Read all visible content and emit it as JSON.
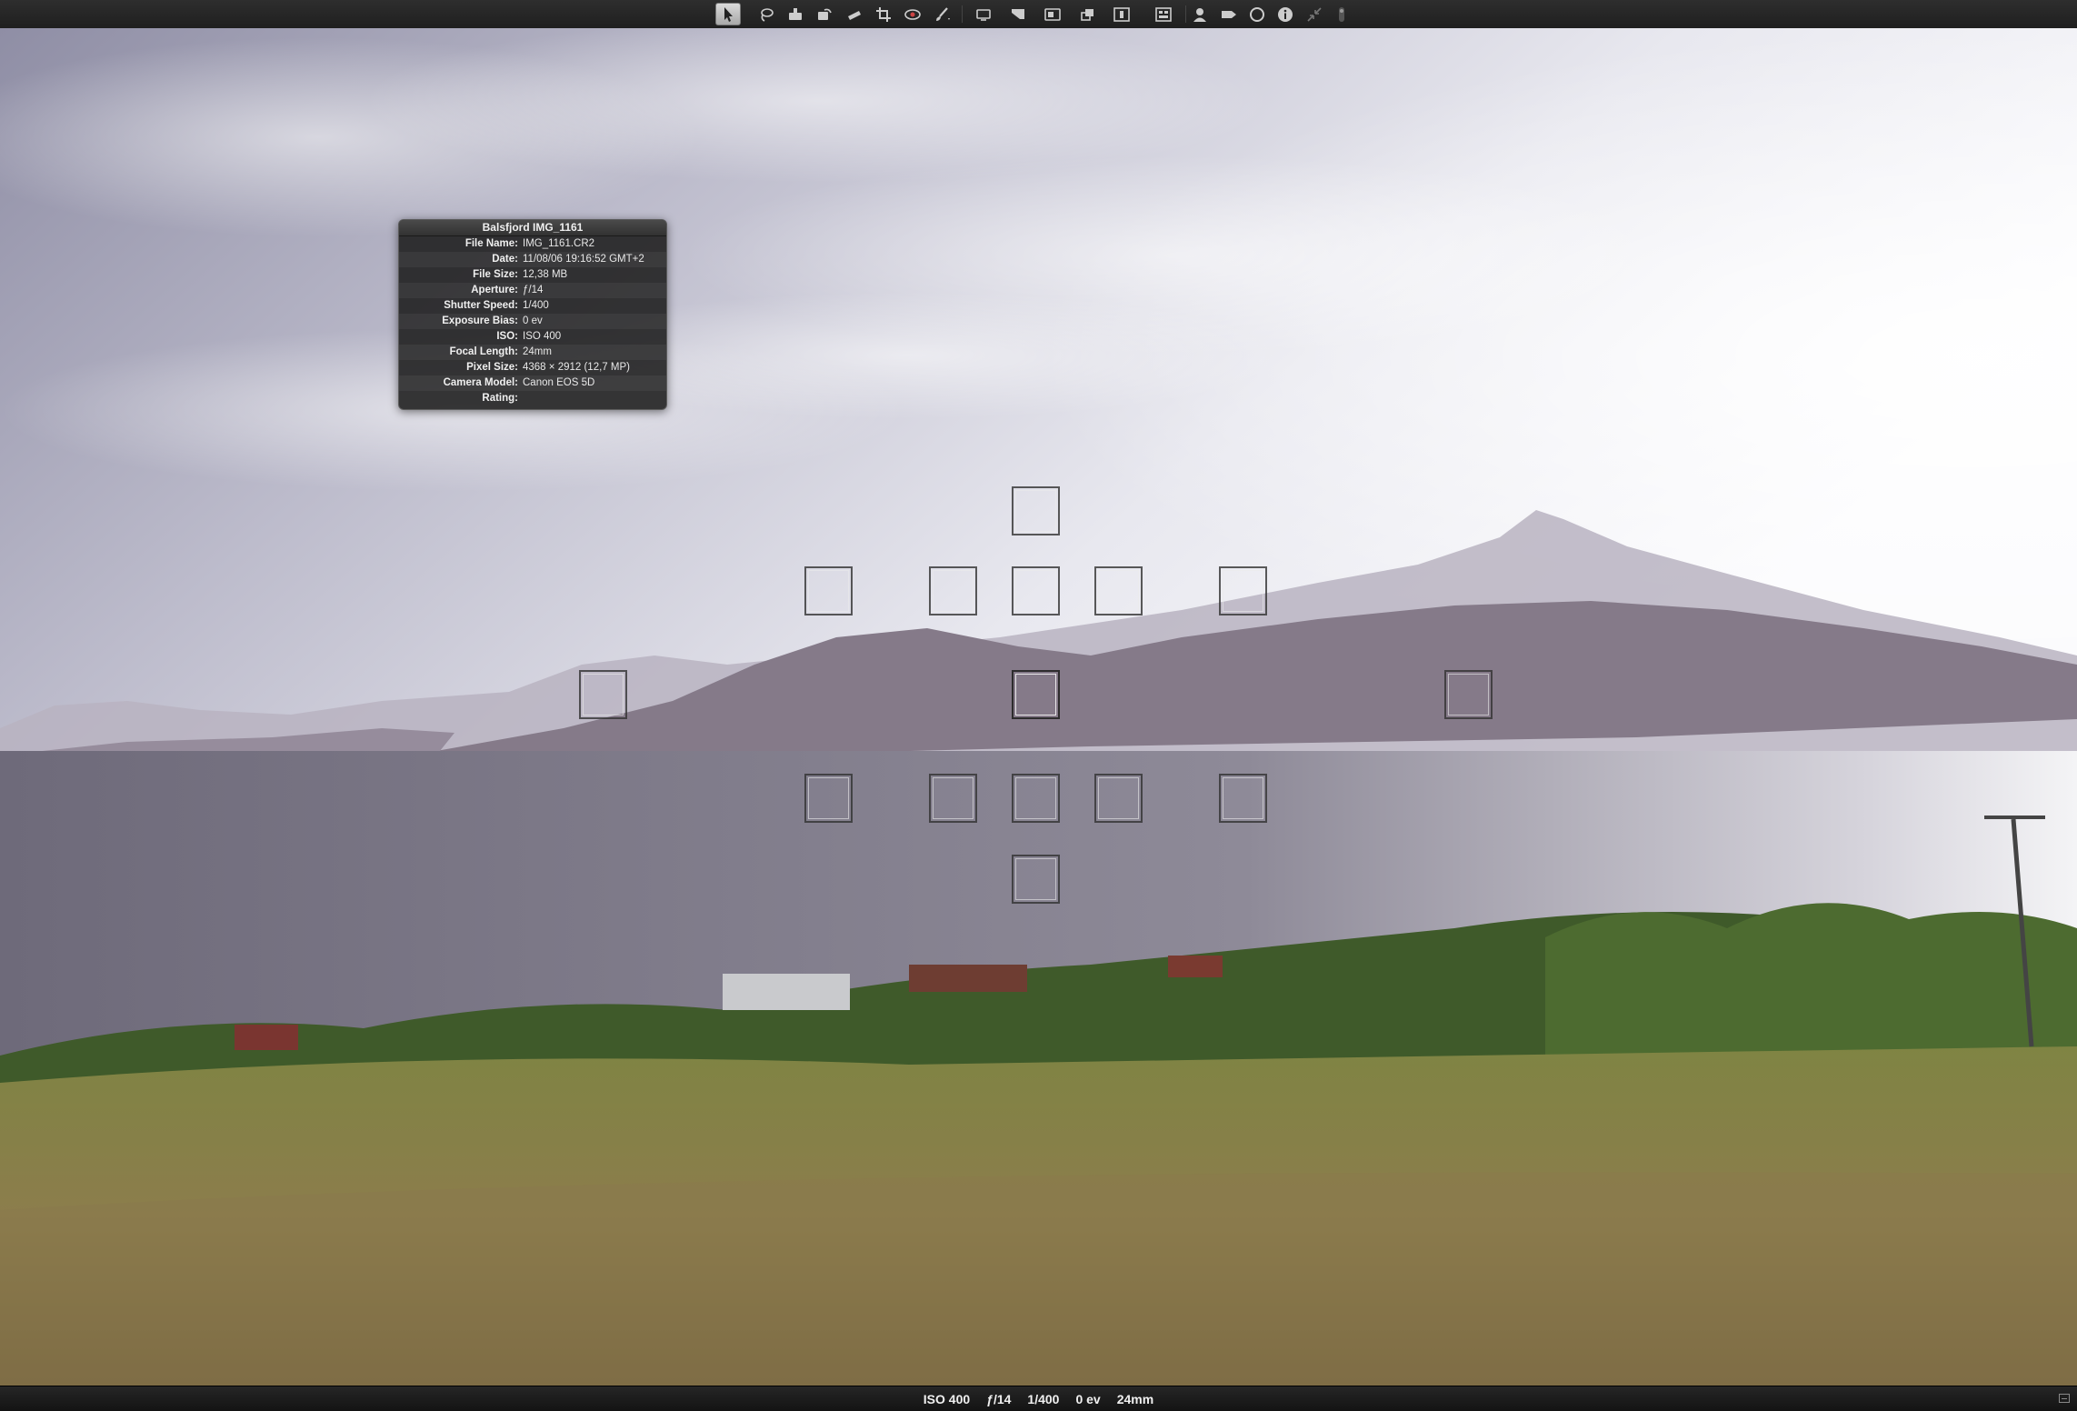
{
  "toolbar": {
    "tools": [
      {
        "name": "select-tool",
        "icon": "arrow-pointer-icon",
        "active": true
      },
      {
        "name": "lasso-tool",
        "icon": "lasso-icon"
      },
      {
        "name": "stamp-tool",
        "icon": "stamp-icon"
      },
      {
        "name": "rotate-tool",
        "icon": "rotate-icon"
      },
      {
        "name": "straighten-tool",
        "icon": "straighten-icon"
      },
      {
        "name": "crop-tool",
        "icon": "crop-icon"
      },
      {
        "name": "redeye-tool",
        "icon": "red-eye-icon"
      },
      {
        "name": "brush-tool",
        "icon": "brush-icon"
      },
      {
        "name": "lift-tool",
        "icon": "lift-icon"
      },
      {
        "name": "stamp-adjust-tool",
        "icon": "stamp-adjust-icon"
      },
      {
        "name": "compare-tool",
        "icon": "compare-icon"
      },
      {
        "name": "stack-tool",
        "icon": "stack-icon"
      },
      {
        "name": "single-view-tool",
        "icon": "single-view-icon"
      },
      {
        "name": "multi-view-tool",
        "icon": "multi-view-icon"
      },
      {
        "name": "faces-tool",
        "icon": "person-icon"
      },
      {
        "name": "tag-tool",
        "icon": "tag-icon"
      },
      {
        "name": "loupe-tool",
        "icon": "loupe-icon"
      },
      {
        "name": "info-tool",
        "icon": "info-icon"
      },
      {
        "name": "fullscreen-exit-tool",
        "icon": "exit-fullscreen-icon"
      },
      {
        "name": "pin-tool",
        "icon": "pin-icon"
      }
    ]
  },
  "hud": {
    "title": "Balsfjord IMG_1161",
    "rows": [
      {
        "key": "File Name:",
        "value": "IMG_1161.CR2"
      },
      {
        "key": "Date:",
        "value": "11/08/06 19:16:52 GMT+2"
      },
      {
        "key": "File Size:",
        "value": "12,38 MB"
      },
      {
        "key": "Aperture:",
        "value": "ƒ/14"
      },
      {
        "key": "Shutter Speed:",
        "value": "1/400"
      },
      {
        "key": "Exposure Bias:",
        "value": "0 ev"
      },
      {
        "key": "ISO:",
        "value": "ISO 400"
      },
      {
        "key": "Focal Length:",
        "value": "24mm"
      },
      {
        "key": "Pixel Size:",
        "value": "4368 × 2912 (12,7 MP)"
      },
      {
        "key": "Camera Model:",
        "value": "Canon EOS 5D"
      },
      {
        "key": "Rating:",
        "value": ""
      }
    ]
  },
  "status": {
    "iso": "ISO 400",
    "aperture": "ƒ/14",
    "shutter": "1/400",
    "exposure": "0 ev",
    "focal": "24mm"
  }
}
